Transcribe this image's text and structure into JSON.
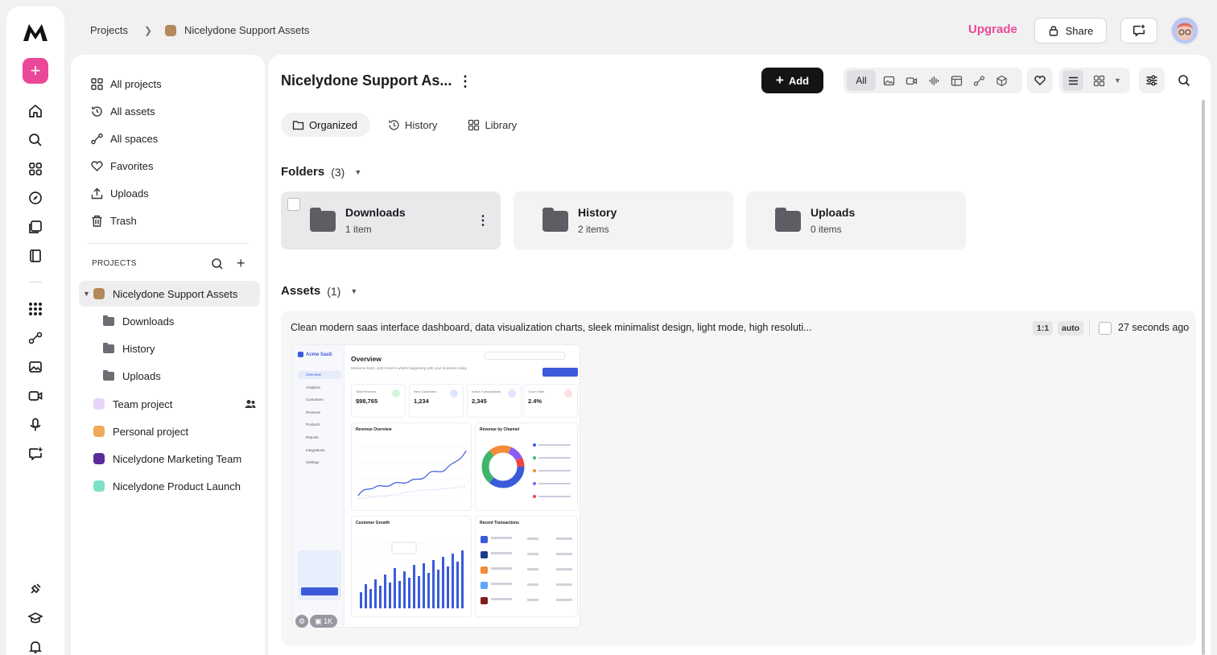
{
  "breadcrumb": {
    "root": "Projects",
    "current": "Nicelydone Support Assets"
  },
  "header": {
    "upgrade": "Upgrade",
    "share": "Share"
  },
  "sidebar": {
    "nav": [
      {
        "label": "All projects",
        "icon": "grid-icon"
      },
      {
        "label": "All assets",
        "icon": "history-icon"
      },
      {
        "label": "All spaces",
        "icon": "spaces-icon"
      },
      {
        "label": "Favorites",
        "icon": "heart-icon"
      },
      {
        "label": "Uploads",
        "icon": "upload-icon"
      },
      {
        "label": "Trash",
        "icon": "trash-icon"
      }
    ],
    "projects_heading": "PROJECTS",
    "active_project": "Nicelydone Support Assets",
    "sub_folders": [
      "Downloads",
      "History",
      "Uploads"
    ],
    "projects": [
      {
        "label": "Team project",
        "color": "#e8d6f9"
      },
      {
        "label": "Personal project",
        "color": "#f0a85a"
      },
      {
        "label": "Nicelydone Marketing Team",
        "color": "#5b2a9b"
      },
      {
        "label": "Nicelydone Product Launch",
        "color": "#7fe0c8"
      }
    ]
  },
  "main": {
    "title": "Nicelydone Support As...",
    "add_label": "Add",
    "filter_all": "All",
    "tabs": [
      "Organized",
      "History",
      "Library"
    ],
    "folders_label": "Folders",
    "folders_count": "(3)",
    "folders": [
      {
        "name": "Downloads",
        "count": "1 item"
      },
      {
        "name": "History",
        "count": "2 items"
      },
      {
        "name": "Uploads",
        "count": "0 items"
      }
    ],
    "assets_label": "Assets",
    "assets_count": "(1)",
    "asset": {
      "prompt": "Clean modern saas interface dashboard, data visualization charts, sleek minimalist design, light mode, high resoluti...",
      "ratio": "1:1",
      "mode": "auto",
      "time": "27 seconds ago",
      "badge_count": "1K"
    }
  },
  "thumbnail": {
    "brand": "Acme SaaS",
    "heading": "Overview",
    "subheading": "Welcome back, John! Here's what's happening with your business today.",
    "nav": [
      "Overview",
      "Analytics",
      "Customers",
      "Revenue",
      "Products",
      "Reports",
      "Integrations",
      "Settings"
    ],
    "kpis": [
      {
        "label": "Total Revenue",
        "value": "$98,765"
      },
      {
        "label": "New Customers",
        "value": "1,234"
      },
      {
        "label": "Active Subscriptions",
        "value": "2,345"
      },
      {
        "label": "Churn Rate",
        "value": "2.4%"
      }
    ],
    "cards": [
      "Revenue Overview",
      "Revenue by Channel",
      "Customer Growth",
      "Recent Transactions"
    ]
  },
  "colors": {
    "accent": "#ec4899",
    "project": "#b38a5c",
    "primary": "#141416"
  }
}
